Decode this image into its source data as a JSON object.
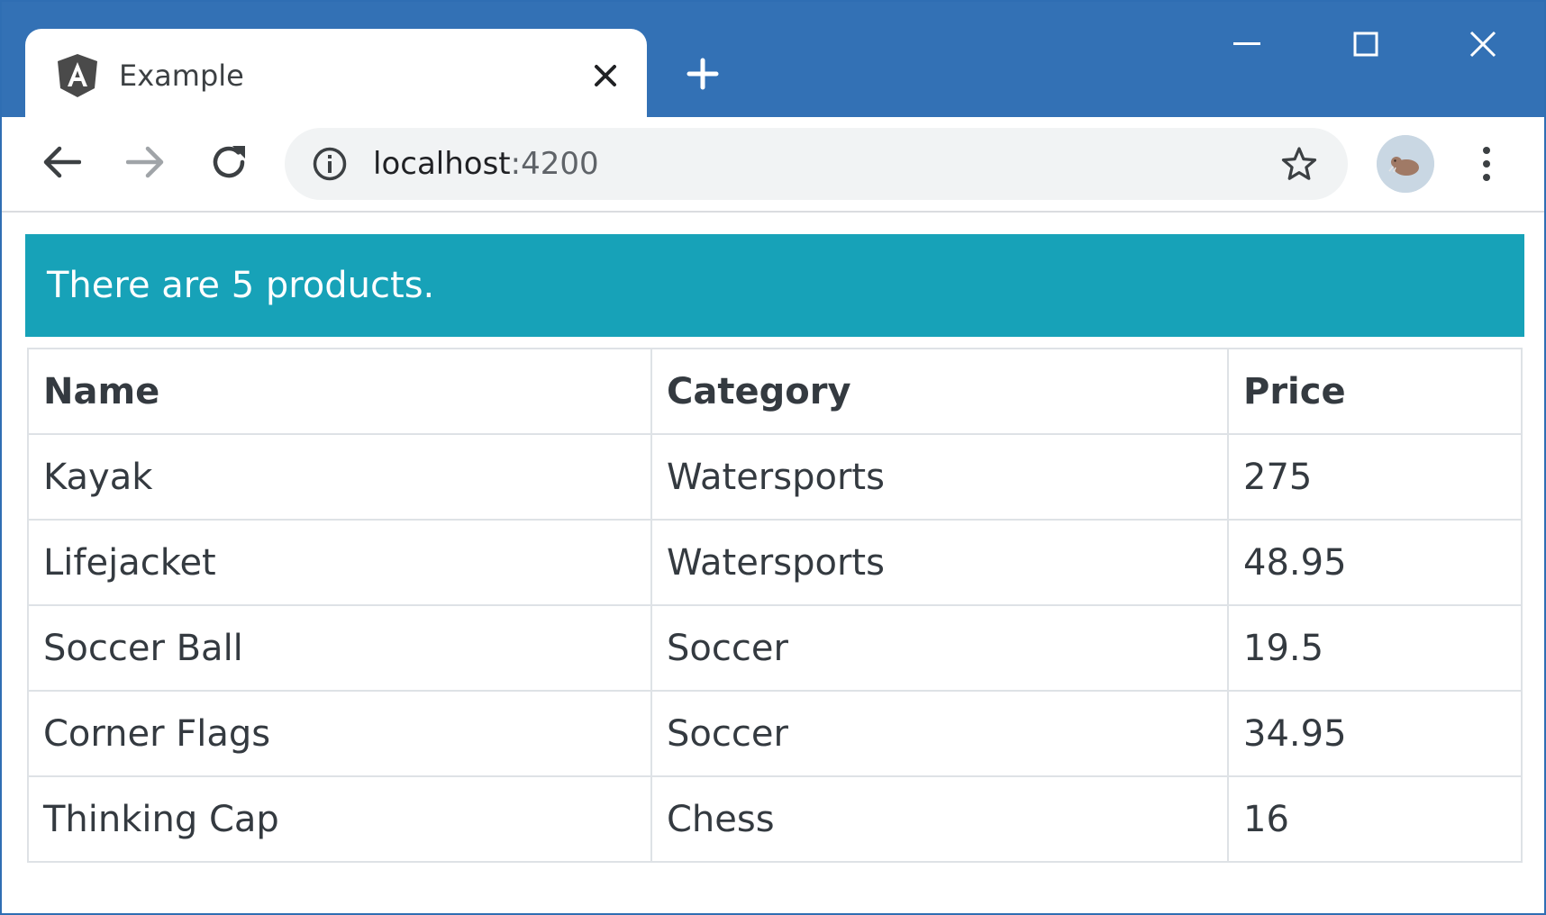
{
  "browser": {
    "tab": {
      "title": "Example",
      "icon": "angular-logo-icon"
    },
    "address_bar": {
      "host": "localhost",
      "port": ":4200"
    },
    "colors": {
      "titlebar": "#3371b5",
      "toolbar": "#ffffff",
      "omnibox": "#f1f3f4"
    }
  },
  "page": {
    "banner": {
      "text": "There are 5 products.",
      "color": "#17a2b8"
    },
    "table": {
      "headers": [
        "Name",
        "Category",
        "Price"
      ],
      "rows": [
        [
          "Kayak",
          "Watersports",
          "275"
        ],
        [
          "Lifejacket",
          "Watersports",
          "48.95"
        ],
        [
          "Soccer Ball",
          "Soccer",
          "19.5"
        ],
        [
          "Corner Flags",
          "Soccer",
          "34.95"
        ],
        [
          "Thinking Cap",
          "Chess",
          "16"
        ]
      ]
    }
  }
}
